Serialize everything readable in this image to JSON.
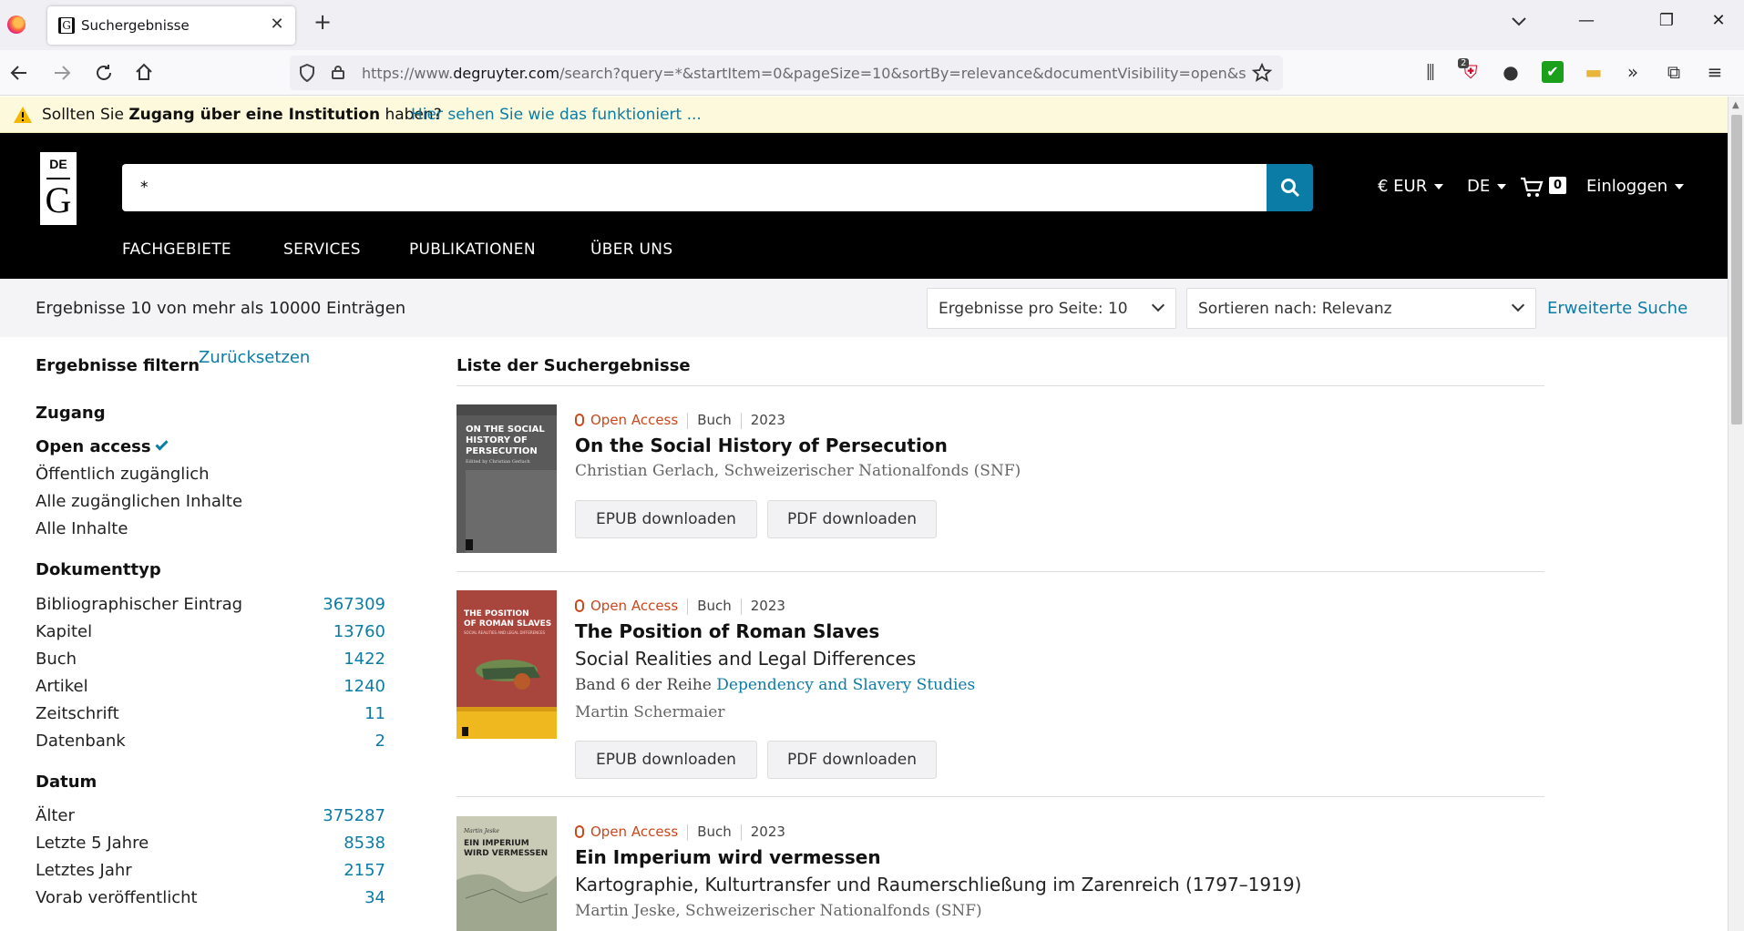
{
  "browser": {
    "tab_title": "Suchergebnisse",
    "url_prefix": "https://www.",
    "url_domain": "degruyter.com",
    "url_path": "/search?query=*&startItem=0&pageSize=10&sortBy=relevance&documentVisibility=open&subject",
    "extension_badge": "2",
    "icons": [
      "firefox-logo",
      "back-arrow",
      "forward-arrow",
      "reload",
      "home",
      "shield",
      "lock",
      "bookmark-star",
      "library",
      "extensions",
      "menu"
    ]
  },
  "notice": {
    "prefix": "Sollten Sie ",
    "bold": "Zugang über eine Institution",
    "suffix": " haben?",
    "link": "Hier sehen Sie wie das funktioniert ..."
  },
  "header": {
    "logo_top": "DE",
    "logo_bottom": "G",
    "search_value": "*",
    "currency": "€ EUR",
    "language": "DE",
    "cart_count": "0",
    "login": "Einloggen",
    "nav": [
      "FACHGEBIETE",
      "SERVICES",
      "PUBLIKATIONEN",
      "ÜBER UNS"
    ]
  },
  "results_bar": {
    "count_text": "Ergebnisse 10 von mehr als 10000 Einträgen",
    "per_page": "Ergebnisse pro Seite: 10",
    "sort": "Sortieren nach: Relevanz",
    "advanced": "Erweiterte Suche"
  },
  "sidebar": {
    "title": "Ergebnisse filtern",
    "reset": "Zurücksetzen",
    "access": {
      "heading": "Zugang",
      "options": [
        "Open access",
        "Öffentlich zugänglich",
        "Alle zugänglichen Inhalte",
        "Alle Inhalte"
      ]
    },
    "doctype": {
      "heading": "Dokumenttyp",
      "rows": [
        {
          "label": "Bibliographischer Eintrag",
          "count": "367309"
        },
        {
          "label": "Kapitel",
          "count": "13760"
        },
        {
          "label": "Buch",
          "count": "1422"
        },
        {
          "label": "Artikel",
          "count": "1240"
        },
        {
          "label": "Zeitschrift",
          "count": "11"
        },
        {
          "label": "Datenbank",
          "count": "2"
        }
      ]
    },
    "date": {
      "heading": "Datum",
      "rows": [
        {
          "label": "Älter",
          "count": "375287"
        },
        {
          "label": "Letzte 5 Jahre",
          "count": "8538"
        },
        {
          "label": "Letztes Jahr",
          "count": "2157"
        },
        {
          "label": "Vorab veröffentlicht",
          "count": "34"
        }
      ]
    }
  },
  "results": {
    "heading": "Liste der Suchergebnisse",
    "accent_oa": "#c9481c",
    "accent_link": "#0b7ca5",
    "items": [
      {
        "access": "Open Access",
        "type": "Buch",
        "year": "2023",
        "title": "On the Social History of Persecution",
        "authors": "Christian Gerlach, Schweizerischer Nationalfonds (SNF)",
        "cover_lines": [
          "ON THE SOCIAL",
          "HISTORY OF",
          "PERSECUTION"
        ],
        "cover_editor": "Edited by Christian Gerlach",
        "epub": "EPUB downloaden",
        "pdf": "PDF downloaden"
      },
      {
        "access": "Open Access",
        "type": "Buch",
        "year": "2023",
        "title": "The Position of Roman Slaves",
        "subtitle": "Social Realities and Legal Differences",
        "series_prefix": "Band 6 der Reihe ",
        "series_link": "Dependency and Slavery Studies",
        "authors": "Martin Schermaier",
        "cover_lines": [
          "THE POSITION",
          "OF ROMAN SLAVES"
        ],
        "cover_sub": "SOCIAL REALITIES AND LEGAL DIFFERENCES",
        "epub": "EPUB downloaden",
        "pdf": "PDF downloaden"
      },
      {
        "access": "Open Access",
        "type": "Buch",
        "year": "2023",
        "title": "Ein Imperium wird vermessen",
        "subtitle": "Kartographie, Kulturtransfer und Raumerschließung im Zarenreich (1797–1919)",
        "authors": "Martin Jeske, Schweizerischer Nationalfonds (SNF)",
        "cover_author": "Martin Jeske",
        "cover_lines": [
          "EIN IMPERIUM",
          "WIRD VERMESSEN"
        ]
      }
    ]
  }
}
